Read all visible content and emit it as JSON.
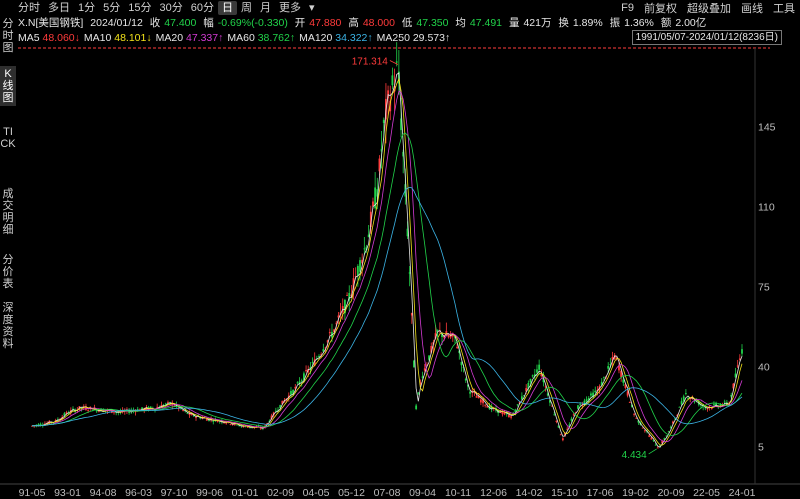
{
  "toolbar": {
    "periods": [
      "分时",
      "多日",
      "1分",
      "5分",
      "15分",
      "30分",
      "60分",
      "日",
      "周",
      "月",
      "更多"
    ],
    "active_period": "日",
    "right_tools": [
      "F9",
      "前复权",
      "超级叠加",
      "画线",
      "工具"
    ],
    "more_arrow": "▾"
  },
  "quote": {
    "symbol": "X.N[美国钢铁]",
    "date": "2024/01/12",
    "close_label": "收",
    "close": "47.400",
    "change_label": "幅",
    "change": "-0.69%(-0.330)",
    "open_label": "开",
    "open": "47.880",
    "high_label": "高",
    "high": "48.000",
    "low_label": "低",
    "low": "47.350",
    "avg_label": "均",
    "avg": "47.491",
    "volume_label": "量",
    "volume": "421万",
    "turnover_label": "换",
    "turnover": "1.89%",
    "amplitude_label": "振",
    "amplitude": "1.36%",
    "amount_label": "额",
    "amount": "2.00亿"
  },
  "ma": [
    {
      "label": "MA5",
      "value": "48.060",
      "arrow": "↓",
      "color": "#e6e6e6",
      "value_color": "#ff3b3b"
    },
    {
      "label": "MA10",
      "value": "48.101",
      "arrow": "↓",
      "color": "#e6e6e6",
      "value_color": "#f2e21a"
    },
    {
      "label": "MA20",
      "value": "47.337",
      "arrow": "↑",
      "color": "#e6e6e6",
      "value_color": "#d43bd4"
    },
    {
      "label": "MA60",
      "value": "38.762",
      "arrow": "↑",
      "color": "#e6e6e6",
      "value_color": "#21d34a"
    },
    {
      "label": "MA120",
      "value": "34.322",
      "arrow": "↑",
      "color": "#e6e6e6",
      "value_color": "#3bb4e6"
    },
    {
      "label": "MA250",
      "value": "29.573",
      "arrow": "↑",
      "color": "#e6e6e6",
      "value_color": "#e6e6e6"
    }
  ],
  "range_text": "1991/05/07-2024/01/12(8236日)",
  "side_tabs": [
    {
      "label": "分时图",
      "active": false
    },
    {
      "label": "K线图",
      "active": true
    },
    {
      "label": "TICK",
      "active": false
    },
    {
      "label": "成交明细",
      "active": false
    },
    {
      "label": "分价表",
      "active": false
    },
    {
      "label": "深度资料",
      "active": false
    }
  ],
  "colors": {
    "up": "#ff3b3b",
    "down": "#21d34a",
    "ma5": "#e6e6e6",
    "ma10": "#f2e21a",
    "ma20": "#d43bd4",
    "ma60": "#21d34a",
    "ma120": "#3bb4e6",
    "ma250": "#9a9a9a"
  },
  "chart_data": {
    "type": "candlestick",
    "title": "",
    "x_ticks": [
      "91-05",
      "93-01",
      "94-08",
      "96-03",
      "97-10",
      "99-06",
      "01-01",
      "02-09",
      "04-05",
      "05-12",
      "07-08",
      "09-04",
      "10-11",
      "12-06",
      "14-02",
      "15-10",
      "17-06",
      "19-02",
      "20-09",
      "22-05",
      "24-01"
    ],
    "y_ticks": [
      5,
      40,
      75,
      110,
      145
    ],
    "ylim": [
      0,
      175
    ],
    "high_annotation": "171.314",
    "low_annotation": "4.434",
    "approx_close_series": [
      {
        "x": "91-05",
        "y": 14
      },
      {
        "x": "92-06",
        "y": 16
      },
      {
        "x": "93-01",
        "y": 20
      },
      {
        "x": "93-08",
        "y": 22
      },
      {
        "x": "94-08",
        "y": 21
      },
      {
        "x": "95-06",
        "y": 20
      },
      {
        "x": "96-03",
        "y": 21
      },
      {
        "x": "97-01",
        "y": 22
      },
      {
        "x": "97-10",
        "y": 24
      },
      {
        "x": "98-08",
        "y": 19
      },
      {
        "x": "99-06",
        "y": 17
      },
      {
        "x": "00-03",
        "y": 16
      },
      {
        "x": "01-01",
        "y": 14
      },
      {
        "x": "02-01",
        "y": 13
      },
      {
        "x": "02-09",
        "y": 22
      },
      {
        "x": "03-06",
        "y": 30
      },
      {
        "x": "04-05",
        "y": 42
      },
      {
        "x": "05-03",
        "y": 55
      },
      {
        "x": "05-12",
        "y": 70
      },
      {
        "x": "06-10",
        "y": 95
      },
      {
        "x": "07-04",
        "y": 120
      },
      {
        "x": "07-08",
        "y": 150
      },
      {
        "x": "08-03",
        "y": 171.3
      },
      {
        "x": "08-09",
        "y": 90
      },
      {
        "x": "09-01",
        "y": 22
      },
      {
        "x": "09-04",
        "y": 35
      },
      {
        "x": "10-01",
        "y": 55
      },
      {
        "x": "10-11",
        "y": 52
      },
      {
        "x": "11-06",
        "y": 30
      },
      {
        "x": "12-06",
        "y": 22
      },
      {
        "x": "13-06",
        "y": 18
      },
      {
        "x": "14-02",
        "y": 30
      },
      {
        "x": "14-09",
        "y": 40
      },
      {
        "x": "15-10",
        "y": 8
      },
      {
        "x": "16-06",
        "y": 22
      },
      {
        "x": "17-06",
        "y": 30
      },
      {
        "x": "18-03",
        "y": 45
      },
      {
        "x": "19-02",
        "y": 18
      },
      {
        "x": "20-03",
        "y": 4.4
      },
      {
        "x": "20-09",
        "y": 12
      },
      {
        "x": "21-06",
        "y": 28
      },
      {
        "x": "22-05",
        "y": 22
      },
      {
        "x": "23-06",
        "y": 24
      },
      {
        "x": "24-01",
        "y": 47.4
      }
    ]
  }
}
